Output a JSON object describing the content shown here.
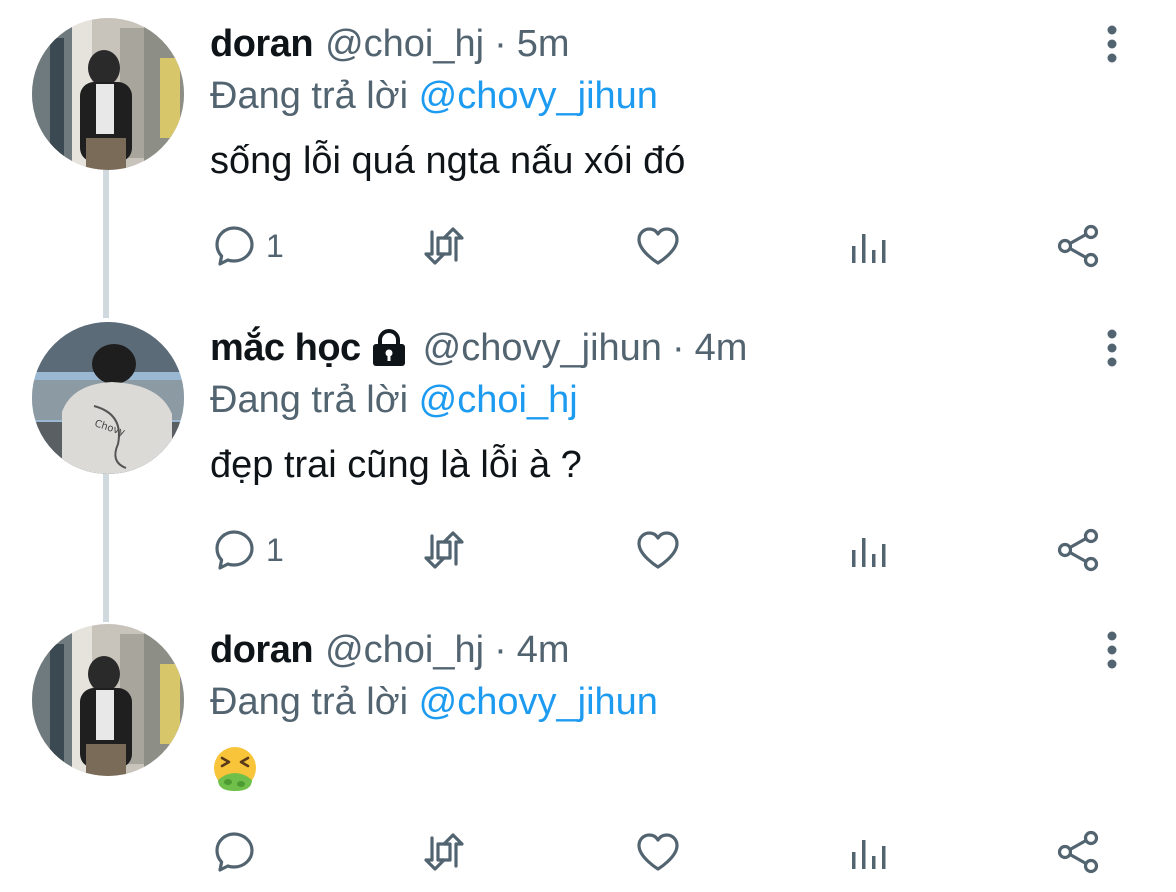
{
  "colors": {
    "primary_text": "#0f1419",
    "secondary_text": "#536471",
    "link": "#1d9bf0",
    "thread_line": "#cfd9de"
  },
  "tweets": [
    {
      "name": "doran",
      "handle": "@choi_hj",
      "dot": "·",
      "time": "5m",
      "reply_prefix": "Đang trả lời",
      "reply_mention": "@chovy_jihun",
      "text": "sống lỗi quá ngta nấu xói đó",
      "reply_count": "1",
      "locked": false
    },
    {
      "name": "mắc học",
      "handle": "@chovy_jihun",
      "dot": "·",
      "time": "4m",
      "reply_prefix": "Đang trả lời",
      "reply_mention": "@choi_hj",
      "text": "đẹp trai cũng là lỗi à ?",
      "reply_count": "1",
      "locked": true
    },
    {
      "name": "doran",
      "handle": "@choi_hj",
      "dot": "·",
      "time": "4m",
      "reply_prefix": "Đang trả lời",
      "reply_mention": "@chovy_jihun",
      "text": "",
      "emoji": "nauseated-face-icon",
      "reply_count": "",
      "locked": false
    }
  ],
  "icons": {
    "reply": "reply-icon",
    "retweet": "retweet-icon",
    "like": "heart-icon",
    "analytics": "analytics-icon",
    "share": "share-icon",
    "more": "more-vertical-icon",
    "lock": "lock-icon"
  }
}
